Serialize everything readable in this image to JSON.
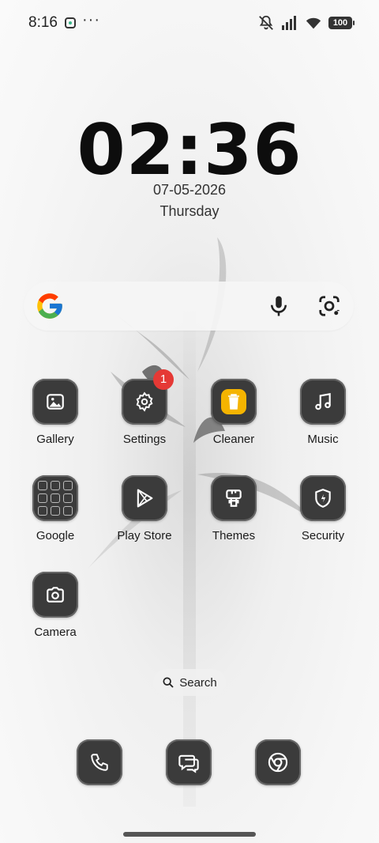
{
  "status_bar": {
    "time": "8:16",
    "overflow": "···",
    "battery": "100",
    "icons": [
      "app-notification-icon",
      "mute-icon",
      "signal-icon",
      "wifi-icon",
      "battery-icon"
    ]
  },
  "clock_widget": {
    "time": "02:36",
    "date": "07-05-2026",
    "day": "Thursday"
  },
  "search_widget": {
    "icons": [
      "google-logo-icon",
      "microphone-icon",
      "google-lens-icon"
    ]
  },
  "apps": [
    {
      "label": "Gallery",
      "icon": "gallery-icon"
    },
    {
      "label": "Settings",
      "icon": "gear-icon",
      "badge": "1"
    },
    {
      "label": "Cleaner",
      "icon": "trash-icon"
    },
    {
      "label": "Music",
      "icon": "music-note-icon"
    },
    {
      "label": "Google",
      "icon": "folder-icon"
    },
    {
      "label": "Play Store",
      "icon": "play-store-icon"
    },
    {
      "label": "Themes",
      "icon": "paint-brush-icon"
    },
    {
      "label": "Security",
      "icon": "shield-icon"
    },
    {
      "label": "Camera",
      "icon": "camera-icon"
    }
  ],
  "app_search": {
    "label": "Search",
    "icon": "search-icon"
  },
  "dock": [
    {
      "icon": "phone-icon"
    },
    {
      "icon": "messages-icon"
    },
    {
      "icon": "chrome-icon"
    }
  ],
  "colors": {
    "badge": "#e53935",
    "tile": "#3b3b3b",
    "cleaner_accent": "#f5b400"
  }
}
